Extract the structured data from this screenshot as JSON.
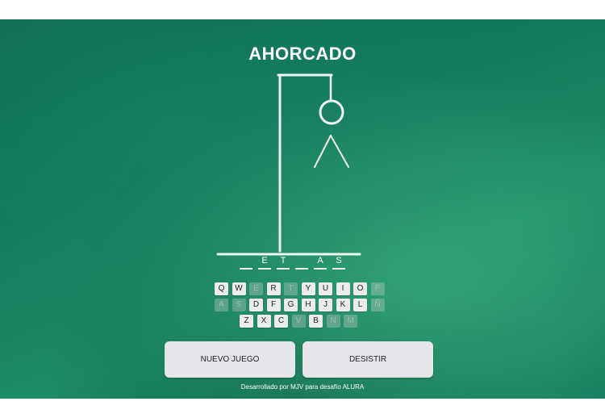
{
  "title": "AHORCADO",
  "word_slots": [
    "",
    "E",
    "T",
    "",
    "A",
    "S"
  ],
  "keyboard": {
    "rows": [
      [
        {
          "k": "Q",
          "used": false
        },
        {
          "k": "W",
          "used": false
        },
        {
          "k": "E",
          "used": true
        },
        {
          "k": "R",
          "used": false
        },
        {
          "k": "T",
          "used": true
        },
        {
          "k": "Y",
          "used": false
        },
        {
          "k": "U",
          "used": false
        },
        {
          "k": "I",
          "used": false
        },
        {
          "k": "O",
          "used": false
        },
        {
          "k": "P",
          "used": true
        }
      ],
      [
        {
          "k": "A",
          "used": true
        },
        {
          "k": "S",
          "used": true
        },
        {
          "k": "D",
          "used": false
        },
        {
          "k": "F",
          "used": false
        },
        {
          "k": "G",
          "used": false
        },
        {
          "k": "H",
          "used": false
        },
        {
          "k": "J",
          "used": false
        },
        {
          "k": "K",
          "used": false
        },
        {
          "k": "L",
          "used": false
        },
        {
          "k": "Ñ",
          "used": true
        }
      ],
      [
        {
          "k": "Z",
          "used": false
        },
        {
          "k": "X",
          "used": false
        },
        {
          "k": "C",
          "used": false
        },
        {
          "k": "V",
          "used": true
        },
        {
          "k": "B",
          "used": false
        },
        {
          "k": "N",
          "used": true
        },
        {
          "k": "M",
          "used": true
        }
      ]
    ]
  },
  "buttons": {
    "new_game": "NUEVO JUEGO",
    "give_up": "DESISTIR"
  },
  "footer": "Desarrollado por MJV para desafío ALURA",
  "colors": {
    "board": "#137a5c",
    "chalk": "#f1f5f2",
    "button_bg": "#e6e6ea"
  }
}
